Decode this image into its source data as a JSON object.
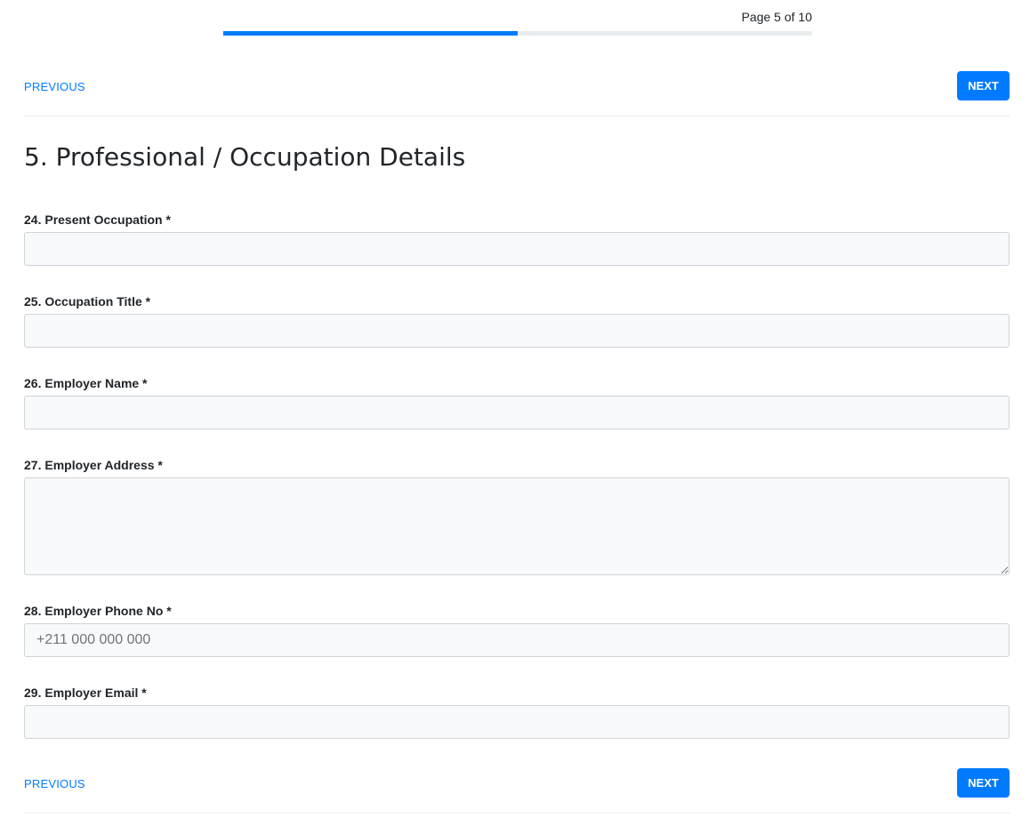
{
  "progress": {
    "page_text": "Page 5 of 10",
    "current_page": 5,
    "total_pages": 10,
    "fraction": 0.5,
    "bar_color": "#007bff",
    "track_color": "#e9ecef"
  },
  "nav": {
    "previous_label": "PREVIOUS",
    "next_label": "NEXT",
    "accent_color": "#007bff"
  },
  "section": {
    "title": "5. Professional / Occupation Details"
  },
  "fields": {
    "present_occupation": {
      "label": "24. Present Occupation *",
      "value": "",
      "placeholder": ""
    },
    "occupation_title": {
      "label": "25. Occupation Title *",
      "value": "",
      "placeholder": ""
    },
    "employer_name": {
      "label": "26. Employer Name *",
      "value": "",
      "placeholder": ""
    },
    "employer_address": {
      "label": "27. Employer Address *",
      "value": "",
      "placeholder": ""
    },
    "employer_phone": {
      "label": "28. Employer Phone No *",
      "value": "",
      "placeholder": "+211 000 000 000"
    },
    "employer_email": {
      "label": "29. Employer Email *",
      "value": "",
      "placeholder": ""
    }
  }
}
